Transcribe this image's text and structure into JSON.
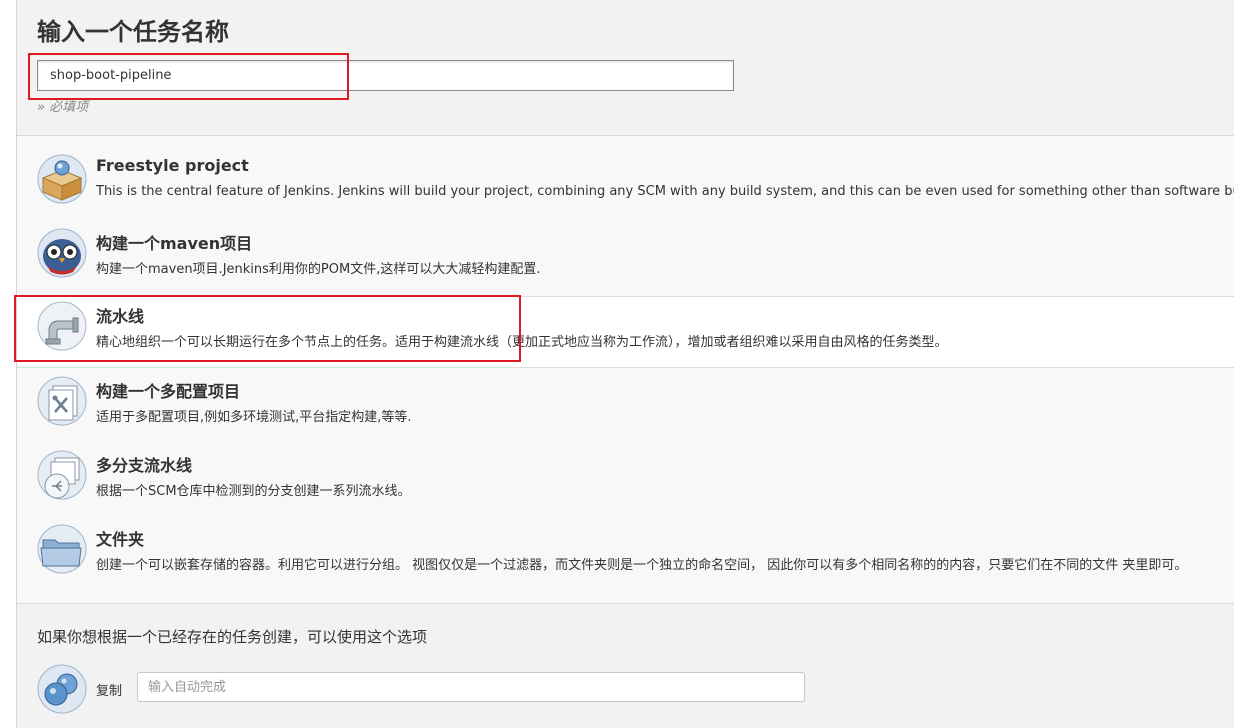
{
  "header": {
    "title": "输入一个任务名称",
    "name_value": "shop-boot-pipeline",
    "required_note": "» 必填项"
  },
  "types": [
    {
      "icon": "freestyle-box-icon",
      "name": "Freestyle project",
      "desc": "This is the central feature of Jenkins. Jenkins will build your project, combining any SCM with any build system, and this can be even used for something other than software build."
    },
    {
      "icon": "maven-owl-icon",
      "name": "构建一个maven项目",
      "desc": "构建一个maven项目.Jenkins利用你的POM文件,这样可以大大减轻构建配置."
    },
    {
      "icon": "pipeline-pipe-icon",
      "name": "流水线",
      "desc": "精心地组织一个可以长期运行在多个节点上的任务。适用于构建流水线（更加正式地应当称为工作流），增加或者组织难以采用自由风格的任务类型。"
    },
    {
      "icon": "multi-config-icon",
      "name": "构建一个多配置项目",
      "desc": "适用于多配置项目,例如多环境测试,平台指定构建,等等."
    },
    {
      "icon": "multibranch-icon",
      "name": "多分支流水线",
      "desc": "根据一个SCM仓库中检测到的分支创建一系列流水线。"
    },
    {
      "icon": "folder-icon",
      "name": "文件夹",
      "desc": "创建一个可以嵌套存储的容器。利用它可以进行分组。 视图仅仅是一个过滤器，而文件夹则是一个独立的命名空间， 因此你可以有多个相同名称的的内容，只要它们在不同的文件 夹里即可。"
    }
  ],
  "copy": {
    "heading": "如果你想根据一个已经存在的任务创建，可以使用这个选项",
    "label": "复制",
    "placeholder": "输入自动完成",
    "icon": "copy-spheres-icon"
  }
}
